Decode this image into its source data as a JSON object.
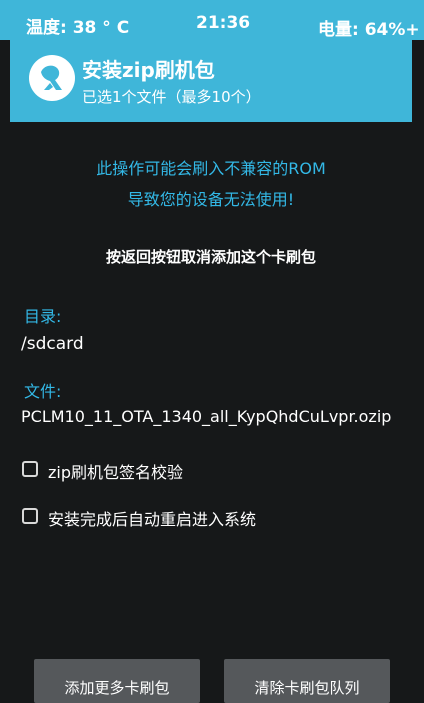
{
  "status_bar": {
    "temperature": "温度: 38 ° C",
    "time": "21:36",
    "battery": "电量: 64%+"
  },
  "header": {
    "title": "安装zip刷机包",
    "subtitle": "已选1个文件（最多10个）",
    "logo_icon": "twrp-logo-icon"
  },
  "warning": {
    "line1": "此操作可能会刷入不兼容的ROM",
    "line2": "导致您的设备无法使用!"
  },
  "back_hint": "按返回按钮取消添加这个卡刷包",
  "directory": {
    "label": "目录:",
    "value": "/sdcard"
  },
  "file": {
    "label": "文件:",
    "value": "PCLM10_11_OTA_1340_all_KypQhdCuLvpr.ozip"
  },
  "options": [
    {
      "label": "zip刷机包签名校验",
      "checked": false
    },
    {
      "label": "安装完成后自动重启进入系统",
      "checked": false
    }
  ],
  "buttons": {
    "add_more": "添加更多卡刷包",
    "clear_queue": "清除卡刷包队列"
  },
  "colors": {
    "accent": "#3fb6d9",
    "warning_text": "#33b8e6",
    "background": "#161819",
    "button": "#55585b"
  }
}
